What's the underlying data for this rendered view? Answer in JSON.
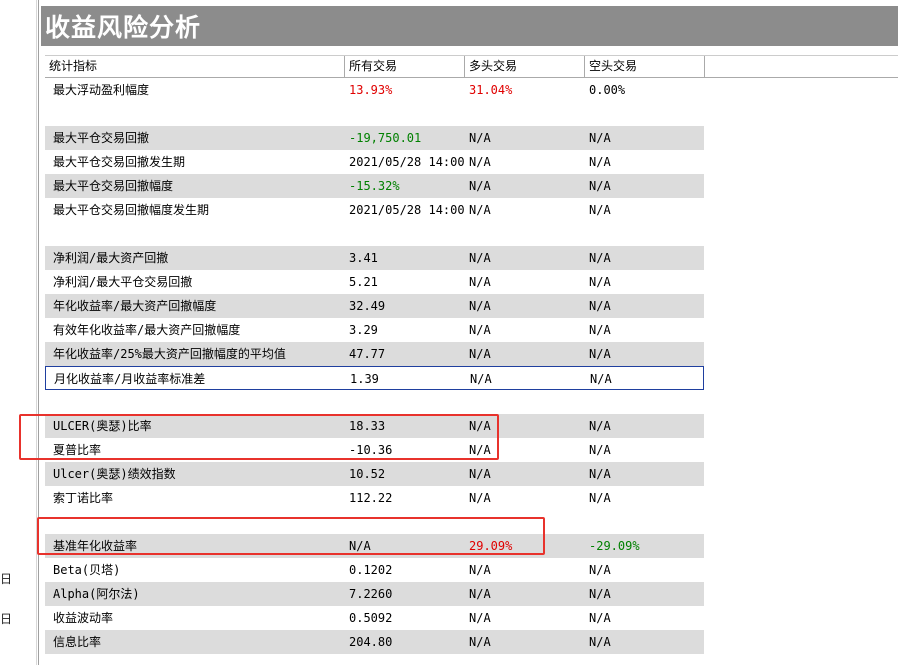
{
  "left_strip": {
    "glyph_1": "日",
    "glyph_2": "日"
  },
  "panel": {
    "title": "收益风险分析"
  },
  "columns": [
    "统计指标",
    "所有交易",
    "多头交易",
    "空头交易"
  ],
  "rows": [
    {
      "label": "最大浮动盈利幅度",
      "all": "13.93%",
      "long": "31.04%",
      "short": "0.00%",
      "style": "white",
      "all_color": "red",
      "long_color": "red"
    },
    {
      "spacer": true
    },
    {
      "label": "最大平仓交易回撤",
      "all": "-19,750.01",
      "long": "N/A",
      "short": "N/A",
      "style": "gray",
      "all_color": "green"
    },
    {
      "label": "最大平仓交易回撤发生期",
      "all": "2021/05/28 14:00",
      "long": "N/A",
      "short": "N/A",
      "style": "white"
    },
    {
      "label": "最大平仓交易回撤幅度",
      "all": "-15.32%",
      "long": "N/A",
      "short": "N/A",
      "style": "gray",
      "all_color": "green"
    },
    {
      "label": "最大平仓交易回撤幅度发生期",
      "all": "2021/05/28 14:00",
      "long": "N/A",
      "short": "N/A",
      "style": "white"
    },
    {
      "spacer": true
    },
    {
      "label": "净利润/最大资产回撤",
      "all": "3.41",
      "long": "N/A",
      "short": "N/A",
      "style": "gray"
    },
    {
      "label": "净利润/最大平仓交易回撤",
      "all": "5.21",
      "long": "N/A",
      "short": "N/A",
      "style": "white"
    },
    {
      "label": "年化收益率/最大资产回撤幅度",
      "all": "32.49",
      "long": "N/A",
      "short": "N/A",
      "style": "gray"
    },
    {
      "label": "有效年化收益率/最大资产回撤幅度",
      "all": "3.29",
      "long": "N/A",
      "short": "N/A",
      "style": "white"
    },
    {
      "label": "年化收益率/25%最大资产回撤幅度的平均值",
      "all": "47.77",
      "long": "N/A",
      "short": "N/A",
      "style": "gray"
    },
    {
      "label": "月化收益率/月收益率标准差",
      "all": "1.39",
      "long": "N/A",
      "short": "N/A",
      "style": "selected"
    },
    {
      "spacer": true
    },
    {
      "label": "ULCER(奥瑟)比率",
      "all": "18.33",
      "long": "N/A",
      "short": "N/A",
      "style": "gray"
    },
    {
      "label": "夏普比率",
      "all": "-10.36",
      "long": "N/A",
      "short": "N/A",
      "style": "white"
    },
    {
      "label": "Ulcer(奥瑟)绩效指数",
      "all": "10.52",
      "long": "N/A",
      "short": "N/A",
      "style": "gray"
    },
    {
      "label": "索丁诺比率",
      "all": "112.22",
      "long": "N/A",
      "short": "N/A",
      "style": "white"
    },
    {
      "spacer": true
    },
    {
      "label": "基准年化收益率",
      "all": "N/A",
      "long": "29.09%",
      "short": "-29.09%",
      "style": "gray",
      "long_color": "red",
      "short_color": "green"
    },
    {
      "label": "Beta(贝塔)",
      "all": "0.1202",
      "long": "N/A",
      "short": "N/A",
      "style": "white"
    },
    {
      "label": "Alpha(阿尔法)",
      "all": "7.2260",
      "long": "N/A",
      "short": "N/A",
      "style": "gray"
    },
    {
      "label": "收益波动率",
      "all": "0.5092",
      "long": "N/A",
      "short": "N/A",
      "style": "white"
    },
    {
      "label": "信息比率",
      "all": "204.80",
      "long": "N/A",
      "short": "N/A",
      "style": "gray"
    }
  ],
  "colors": {
    "red": "#e00000",
    "green": "#008000",
    "title_bg": "#8c8c8c",
    "row_gray": "#dcdcdc",
    "highlight": "#e8322c",
    "selection": "#1f3f9f"
  }
}
